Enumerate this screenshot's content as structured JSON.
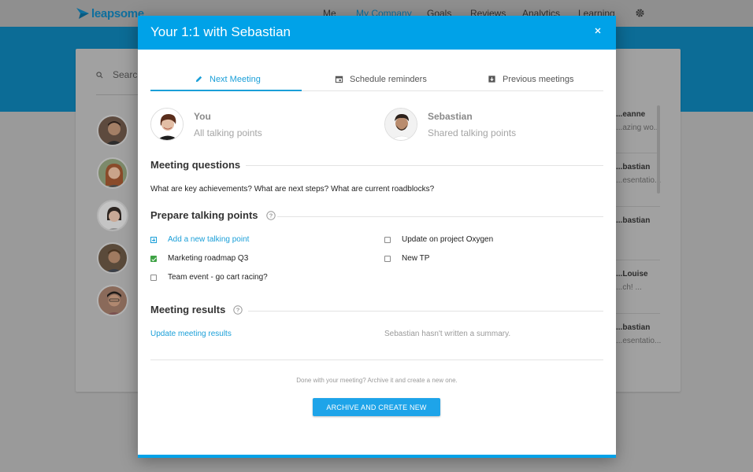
{
  "app": {
    "logo_text": "leapsome",
    "nav": [
      {
        "label": "Me"
      },
      {
        "label": "My Company"
      },
      {
        "label": "Goals"
      },
      {
        "label": "Reviews"
      },
      {
        "label": "Analytics"
      },
      {
        "label": "Learning"
      }
    ],
    "settings_icon": "gear-icon"
  },
  "background": {
    "search_placeholder": "Search",
    "list": [
      {
        "name": "...eanne",
        "snippet": "...azing wo..."
      },
      {
        "name": "...bastian",
        "snippet": "...esentatio..."
      },
      {
        "name": "...bastian",
        "snippet": ""
      },
      {
        "name": "...Louise",
        "snippet": "...ch! ..."
      },
      {
        "name": "...bastian",
        "snippet": "...esentatio..."
      }
    ]
  },
  "modal": {
    "title": "Your 1:1 with Sebastian",
    "close_icon": "close-icon",
    "tabs": [
      {
        "label": "Next Meeting",
        "icon": "pencil-icon",
        "active": true
      },
      {
        "label": "Schedule reminders",
        "icon": "calendar-icon",
        "active": false
      },
      {
        "label": "Previous meetings",
        "icon": "archive-icon",
        "active": false
      }
    ],
    "you": {
      "name": "You",
      "subtitle": "All talking points"
    },
    "other": {
      "name": "Sebastian",
      "subtitle": "Shared talking points"
    },
    "questions": {
      "title": "Meeting questions",
      "text": "What are key achievements? What are next steps? What are current roadblocks?"
    },
    "talking_points": {
      "title": "Prepare talking points",
      "add_label": "Add a new talking point",
      "left": [
        {
          "label": "Marketing roadmap Q3",
          "checked": true
        },
        {
          "label": "Team event - go cart racing?",
          "checked": false
        }
      ],
      "right": [
        {
          "label": "Update on project Oxygen",
          "checked": false
        },
        {
          "label": "New TP",
          "checked": false
        }
      ]
    },
    "results": {
      "title": "Meeting results",
      "update_link": "Update meeting results",
      "summary": "Sebastian hasn't written a summary."
    },
    "footer": {
      "text": "Done with your meeting? Archive it and create a new one.",
      "button": "ARCHIVE AND CREATE NEW"
    },
    "colors": {
      "accent": "#00a2e8",
      "check": "#3da244"
    }
  }
}
